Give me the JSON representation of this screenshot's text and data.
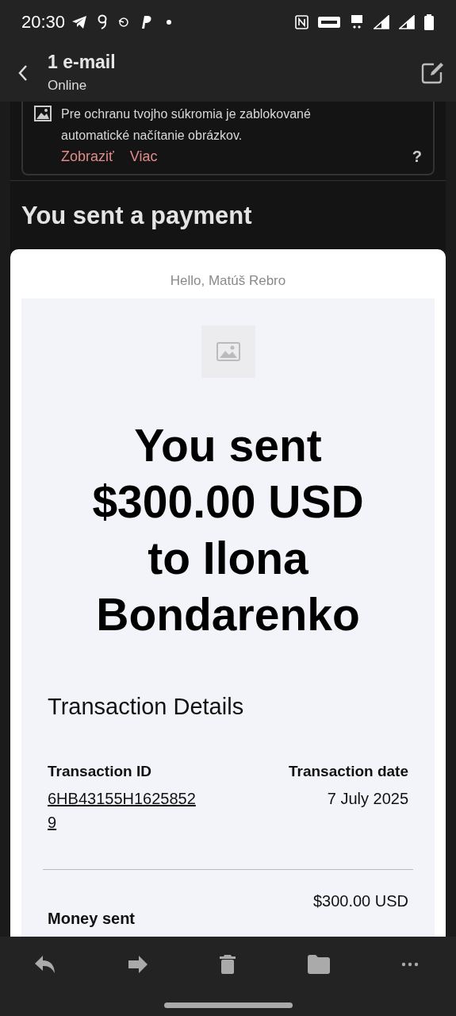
{
  "status_bar": {
    "time": "20:30"
  },
  "header": {
    "title": "1 e-mail",
    "subtitle": "Online"
  },
  "image_notice": {
    "text": "Pre ochranu tvojho súkromia je zablokované automatické načítanie obrázkov.",
    "actions": [
      "Zobraziť",
      "Viac"
    ],
    "help": "?"
  },
  "subject": "You sent a payment",
  "email": {
    "greeting": "Hello, Matúš Rebro",
    "headline": "You sent $300.00 USD to Ilona Bondarenko",
    "section_title": "Transaction Details",
    "details": [
      {
        "label": "Transaction ID",
        "value": "6HB43155H16258529",
        "kind": "link"
      },
      {
        "label": "Transaction date",
        "value": "7 July 2025",
        "kind": "text"
      }
    ],
    "money_label": "Money sent",
    "money_value": "$300.00 USD"
  }
}
